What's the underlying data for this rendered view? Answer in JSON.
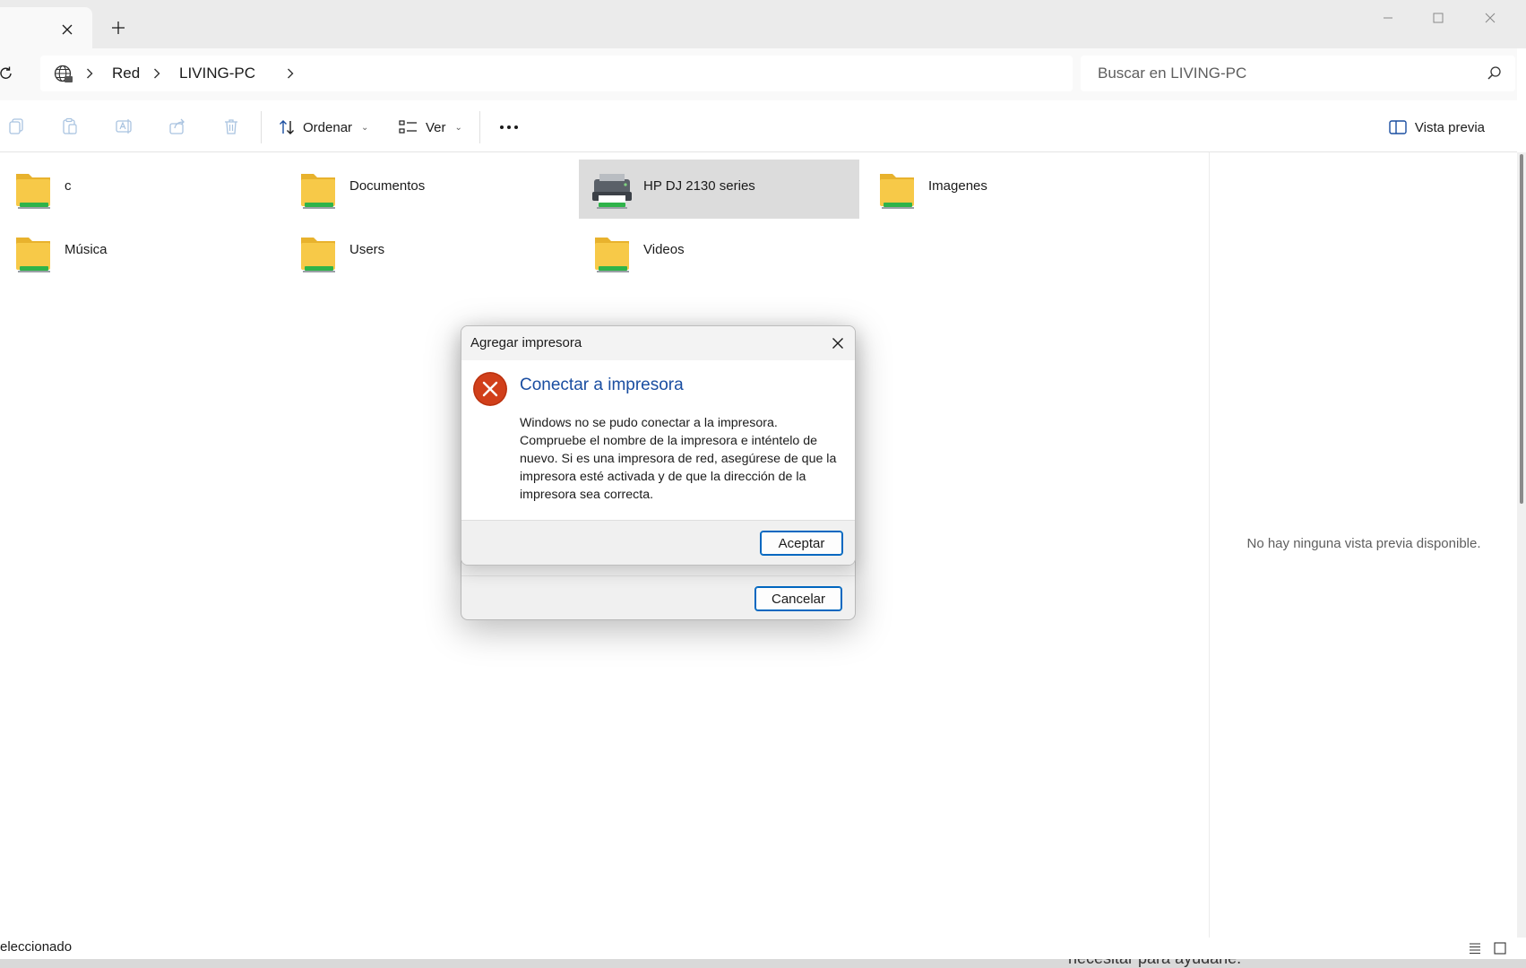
{
  "window": {
    "tab_close_icon": "close-icon",
    "new_tab_icon": "plus-icon",
    "controls": [
      "minimize-icon",
      "maximize-icon",
      "close-icon"
    ]
  },
  "address_bar": {
    "location_icon": "network-globe-icon",
    "breadcrumbs": [
      "Red",
      "LIVING-PC"
    ],
    "search_placeholder": "Buscar en LIVING-PC"
  },
  "command_bar": {
    "icons": [
      "copy-icon",
      "paste-icon",
      "rename-icon",
      "share-icon",
      "delete-icon"
    ],
    "sort_label": "Ordenar",
    "view_label": "Ver",
    "more_icon": "more-options-icon",
    "preview_label": "Vista previa"
  },
  "items": [
    {
      "label": "c",
      "icon": "shared-folder-icon"
    },
    {
      "label": "Documentos",
      "icon": "shared-folder-icon"
    },
    {
      "label": "HP DJ 2130 series",
      "icon": "printer-icon",
      "selected": true
    },
    {
      "label": "Imagenes",
      "icon": "shared-folder-icon"
    },
    {
      "label": "Música",
      "icon": "shared-folder-icon"
    },
    {
      "label": "Users",
      "icon": "shared-folder-icon"
    },
    {
      "label": "Videos",
      "icon": "shared-folder-icon"
    }
  ],
  "preview_pane": {
    "message": "No hay ninguna vista previa disponible."
  },
  "status_bar": {
    "text": "eleccionado",
    "background_text": "necesitar para ayudarle."
  },
  "back_dialog": {
    "cancel_label": "Cancelar"
  },
  "error_dialog": {
    "title": "Agregar impresora",
    "heading": "Conectar a impresora",
    "body": "Windows no se pudo conectar a la impresora. Compruebe el nombre de la impresora e inténtelo de nuevo. Si es una impresora de red, asegúrese de que la impresora esté activada y de que la dirección de la impresora sea correcta.",
    "ok_label": "Aceptar",
    "icon": "error-icon",
    "heading_color": "#1a4ea1",
    "error_color": "#d13f1a"
  },
  "colors": {
    "accent": "#0067c0",
    "folder": "#f7c948",
    "share_bar": "#2fb34a"
  }
}
